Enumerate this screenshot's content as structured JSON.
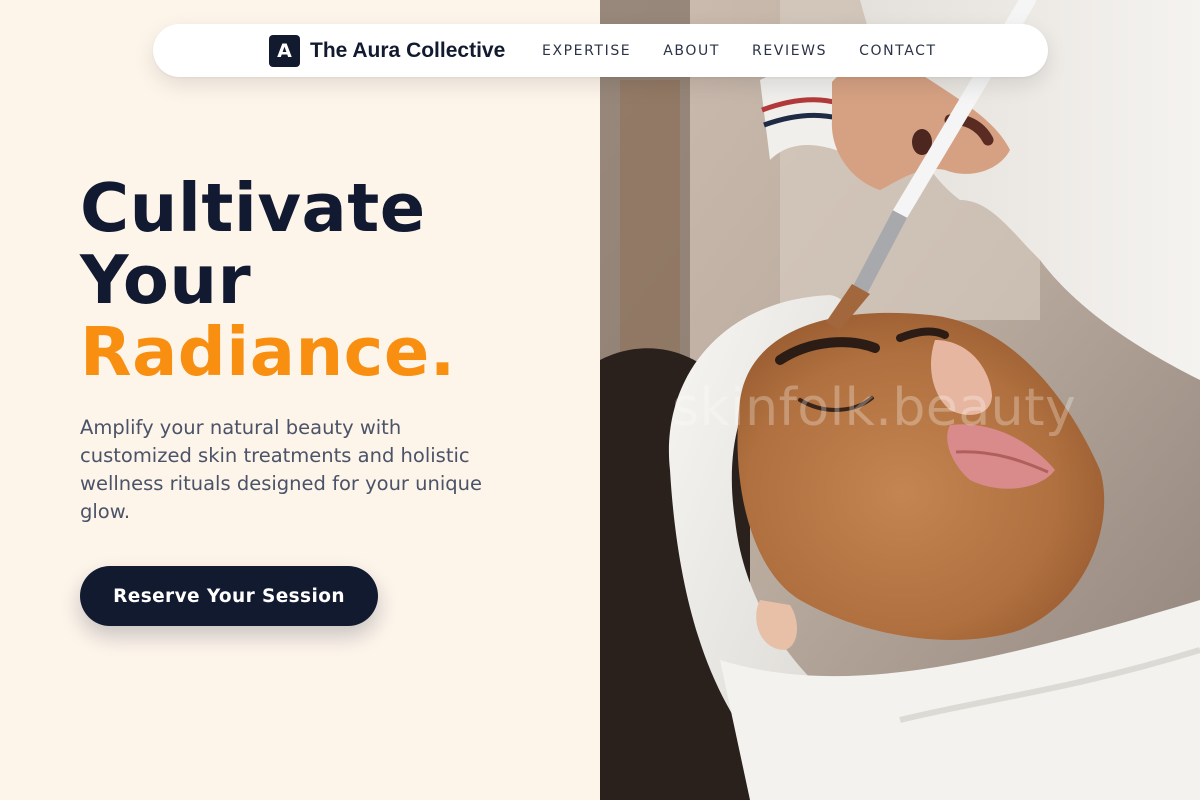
{
  "brand": {
    "mark": "A",
    "name": "The Aura Collective"
  },
  "nav": {
    "links": [
      "EXPERTISE",
      "ABOUT",
      "REVIEWS",
      "CONTACT"
    ]
  },
  "hero": {
    "headline": [
      "Cultivate",
      "Your"
    ],
    "headline_accent": "Radiance.",
    "subtext": "Amplify your natural beauty with customized skin treatments and holistic wellness rituals designed for your unique glow.",
    "cta_label": "Reserve Your Session",
    "image_watermark": "skinfolk.beauty"
  },
  "colors": {
    "page_background": "#fdf4ea",
    "primary_dark": "#121a30",
    "accent_orange": "#f88f10",
    "body_text": "#4a5368"
  },
  "icons": {
    "brand_logo": "letter-a-logo-icon"
  }
}
